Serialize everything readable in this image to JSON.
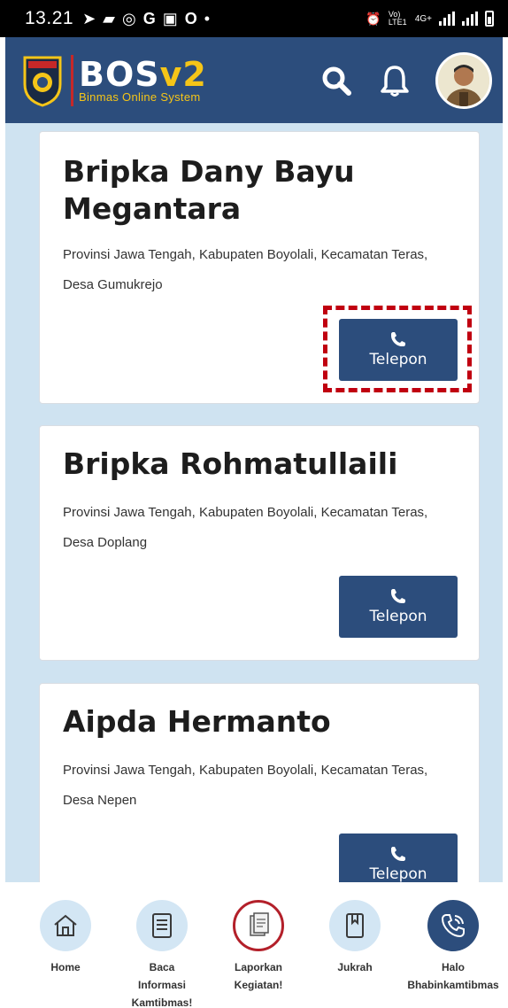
{
  "status_bar": {
    "time": "13.21",
    "network_label": "4G+",
    "volte_label": "Vo) LTE1"
  },
  "header": {
    "brand_title_main": "BOS",
    "brand_title_version": "v2",
    "brand_subtitle": "Binmas Online System",
    "search_icon": "search-icon",
    "notification_icon": "bell-icon"
  },
  "officers": [
    {
      "name": "Bripka Dany Bayu Megantara",
      "address": "Provinsi Jawa Tengah, Kabupaten Boyolali, Kecamatan Teras, Desa Gumukrejo",
      "call_label": "Telepon",
      "highlighted": true
    },
    {
      "name": "Bripka Rohmatullaili",
      "address": "Provinsi Jawa Tengah, Kabupaten Boyolali, Kecamatan Teras, Desa Doplang",
      "call_label": "Telepon",
      "highlighted": false
    },
    {
      "name": "Aipda Hermanto",
      "address": "Provinsi Jawa Tengah, Kabupaten Boyolali, Kecamatan Teras, Desa Nepen",
      "call_label": "Telepon",
      "highlighted": false
    }
  ],
  "bottom_nav": [
    {
      "label": "Home",
      "icon": "home-icon",
      "active": false
    },
    {
      "label": "Baca Informasi Kamtibmas!",
      "icon": "document-icon",
      "active": false
    },
    {
      "label": "Laporkan Kegiatan!",
      "icon": "report-icon",
      "active": false
    },
    {
      "label": "Jukrah",
      "icon": "book-icon",
      "active": false
    },
    {
      "label": "Halo Bhabinkamtibmas",
      "icon": "phone-call-icon",
      "active": true
    }
  ],
  "colors": {
    "primary": "#2c4d7c",
    "accent": "#f5c518",
    "content_bg": "#cfe3f1",
    "highlight": "#c00010"
  }
}
